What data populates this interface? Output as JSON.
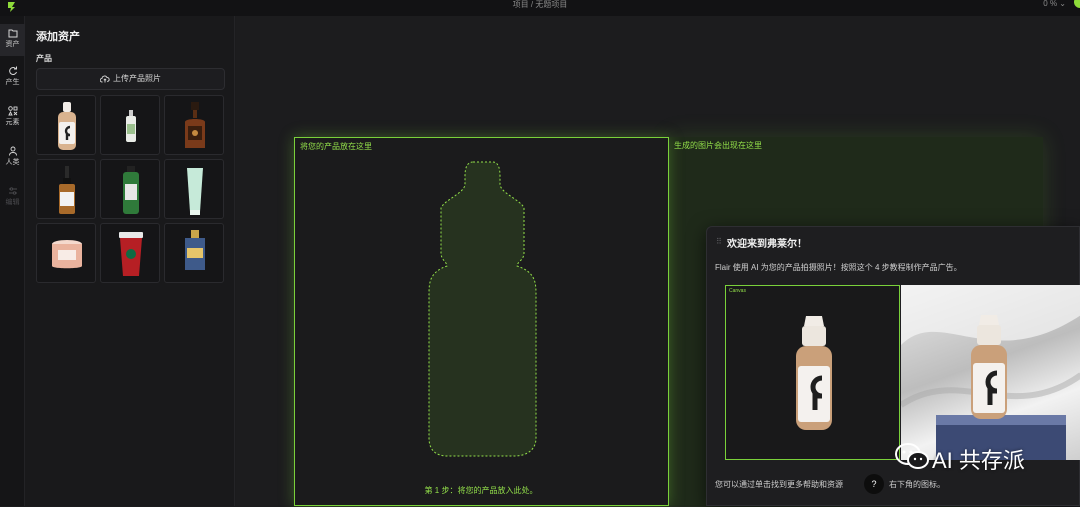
{
  "topbar": {
    "breadcrumb": "项目 / 无题项目",
    "zoom": "0 % ⌄"
  },
  "rail": [
    {
      "label": "资产",
      "icon": "folder-icon",
      "active": true
    },
    {
      "label": "产生",
      "icon": "refresh-icon"
    },
    {
      "label": "元素",
      "icon": "shapes-icon"
    },
    {
      "label": "人类",
      "icon": "person-icon"
    },
    {
      "label": "编辑",
      "icon": "sliders-icon",
      "disabled": true
    }
  ],
  "panel": {
    "title": "添加资产",
    "section": "产品",
    "upload_label": "上传产品照片",
    "thumbnails": [
      "dropper-bottle-g",
      "white-bottle",
      "brown-bottle",
      "serum-dropper",
      "green-bottle",
      "mint-tube",
      "pink-candle",
      "red-cup",
      "perfume"
    ]
  },
  "canvas": {
    "dropzone_label": "将您的产品放在这里",
    "dropzone_step": "第 1 步：将您的产品放入此处。",
    "genzone_label": "生成的图片会出现在这里"
  },
  "modal": {
    "drag_handle": "⠿",
    "title": "欢迎来到弗莱尔！",
    "description": "Flair 使用 AI 为您的产品拍摄照片！按照这个 4 步教程制作产品广告。",
    "canvas_caption": "Canvas",
    "help_text": "您可以通过单击找到更多帮助和资源",
    "help_button": "?",
    "help_text2": "右下角的图标。"
  },
  "watermark": {
    "text": "AI 共存派"
  },
  "colors": {
    "accent": "#7ad13a",
    "background": "#1b1b1d"
  }
}
